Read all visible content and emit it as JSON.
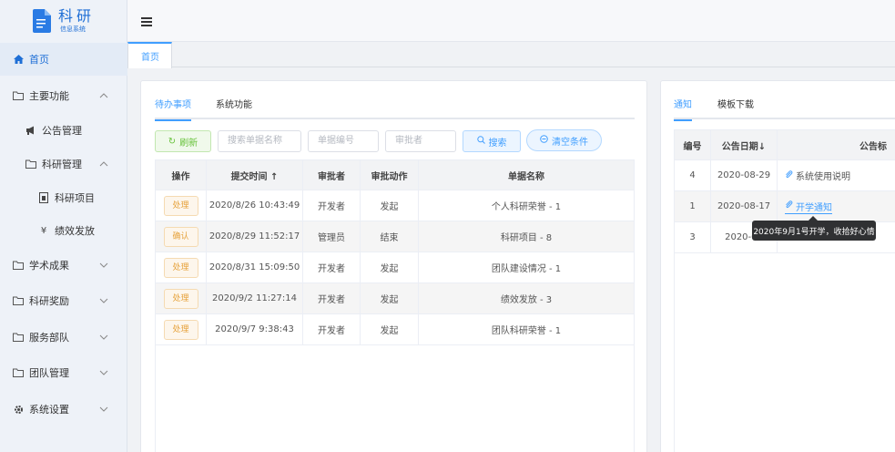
{
  "app": {
    "title": "科研",
    "subtitle": "信息系统"
  },
  "sidebar": {
    "home": "首页",
    "items": [
      {
        "label": "主要功能"
      },
      {
        "label": "公告管理"
      },
      {
        "label": "科研管理"
      },
      {
        "label": "科研项目"
      },
      {
        "label": "绩效发放"
      },
      {
        "label": "学术成果"
      },
      {
        "label": "科研奖励"
      },
      {
        "label": "服务部队"
      },
      {
        "label": "团队管理"
      },
      {
        "label": "系统设置"
      }
    ]
  },
  "tabs": {
    "home": "首页"
  },
  "todo": {
    "tab_pending": "待办事项",
    "tab_system": "系统功能",
    "refresh": "刷新",
    "search_name_placeholder": "搜索单据名称",
    "doc_no_placeholder": "单据编号",
    "approver_placeholder": "审批者",
    "search": "搜索",
    "clear": "清空条件",
    "columns": [
      "操作",
      "提交时间 ↑",
      "审批者",
      "审批动作",
      "单据名称"
    ],
    "rows": [
      {
        "action": "处理",
        "time": "2020/8/26 10:43:49",
        "approver": "开发者",
        "act": "发起",
        "name": "个人科研荣誉 - 1"
      },
      {
        "action": "确认",
        "time": "2020/8/29 11:52:17",
        "approver": "管理员",
        "act": "结束",
        "name": "科研项目 - 8"
      },
      {
        "action": "处理",
        "time": "2020/8/31 15:09:50",
        "approver": "开发者",
        "act": "发起",
        "name": "团队建设情况 - 1"
      },
      {
        "action": "处理",
        "time": "2020/9/2 11:27:14",
        "approver": "开发者",
        "act": "发起",
        "name": "绩效发放 - 3"
      },
      {
        "action": "处理",
        "time": "2020/9/7 9:38:43",
        "approver": "开发者",
        "act": "发起",
        "name": "团队科研荣誉 - 1"
      }
    ]
  },
  "notice": {
    "tab_notice": "通知",
    "tab_download": "模板下载",
    "columns": [
      "编号",
      "公告日期↓",
      "公告标"
    ],
    "rows": [
      {
        "no": "4",
        "date": "2020-08-29",
        "title": "系统使用说明"
      },
      {
        "no": "1",
        "date": "2020-08-17",
        "title": "开学通知"
      },
      {
        "no": "3",
        "date": "2020-08"
      }
    ],
    "tooltip": "2020年9月1号开学，收拾好心情"
  },
  "colors": {
    "accent": "#409eff",
    "brand": "#1f6fd6",
    "warning": "#e6a23c",
    "success": "#67c23a"
  }
}
